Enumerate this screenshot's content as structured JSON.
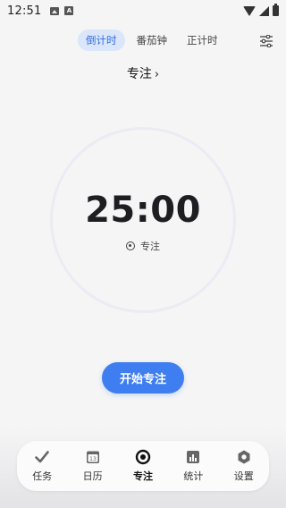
{
  "status_bar": {
    "time": "12:51",
    "a_glyph": "A",
    "icons": [
      "image-icon",
      "a-badge-icon",
      "wifi-icon",
      "signal-icon",
      "battery-icon"
    ]
  },
  "mode_tabs": [
    {
      "label": "倒计时",
      "active": true
    },
    {
      "label": "番茄钟",
      "active": false
    },
    {
      "label": "正计时",
      "active": false
    }
  ],
  "focus": {
    "title": "专注",
    "chevron": "›",
    "timer": "25:00",
    "tag_label": "专注"
  },
  "start_button": {
    "label": "开始专注"
  },
  "bottom_nav": [
    {
      "label": "任务",
      "icon": "check-icon",
      "active": false
    },
    {
      "label": "日历",
      "icon": "calendar-icon",
      "calendar_day": "13",
      "active": false
    },
    {
      "label": "专注",
      "icon": "focus-icon",
      "active": true
    },
    {
      "label": "统计",
      "icon": "chart-icon",
      "active": false
    },
    {
      "label": "设置",
      "icon": "hexagon-settings-icon",
      "active": false
    }
  ],
  "colors": {
    "accent": "#3f7ef0",
    "active_tab_bg": "#dbe6fb",
    "active_tab_text": "#2f6fe0",
    "ring": "#ebecf3",
    "background": "#f5f5f6"
  }
}
